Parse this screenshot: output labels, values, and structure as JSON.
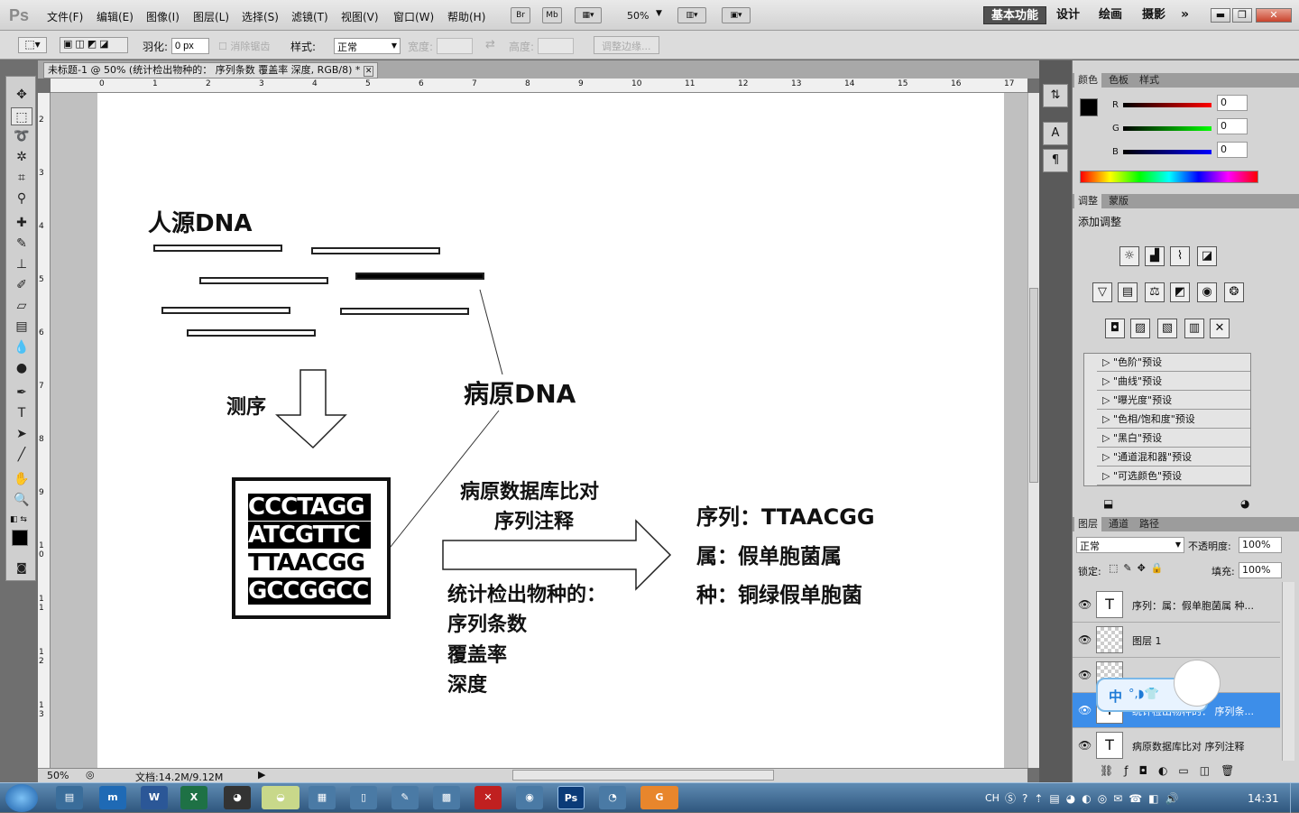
{
  "app": {
    "logo": "Ps"
  },
  "menu": [
    "文件(F)",
    "编辑(E)",
    "图像(I)",
    "图层(L)",
    "选择(S)",
    "滤镜(T)",
    "视图(V)",
    "窗口(W)",
    "帮助(H)"
  ],
  "menubar_buttons": {
    "br": "Br",
    "mb": "Mb",
    "zoom": "50%"
  },
  "workspaces": [
    "基本功能",
    "设计",
    "绘画",
    "摄影"
  ],
  "options": {
    "feather_label": "羽化:",
    "feather_value": "0 px",
    "antialias": "消除锯齿",
    "style_label": "样式:",
    "style_value": "正常",
    "width_label": "宽度:",
    "height_label": "高度:",
    "refine_btn": "调整边缘..."
  },
  "document": {
    "tab_title": "未标题-1 @ 50% (统计检出物种的： 序列条数 覆盖率 深度, RGB/8) *"
  },
  "ruler_top": [
    "0",
    "1",
    "2",
    "3",
    "4",
    "5",
    "6",
    "7",
    "8",
    "9",
    "10",
    "11",
    "12",
    "13",
    "14",
    "15",
    "16",
    "17"
  ],
  "ruler_left": [
    "2",
    "3",
    "4",
    "5",
    "6",
    "7",
    "8",
    "9",
    "1 0",
    "1 1",
    "1 2",
    "1 3"
  ],
  "canvas": {
    "human_dna": "人源DNA",
    "sequencing": "测序",
    "pathogen_dna": "病原DNA",
    "seq_lines": [
      "CCCTAGG",
      "ATCGTTC",
      "TTAACGG",
      "GCCGGCC"
    ],
    "db_compare": "病原数据库比对",
    "seq_annot": "序列注释",
    "stats_title": "统计检出物种的：",
    "stats_items": [
      "序列条数",
      "覆盖率",
      "深度"
    ],
    "result_seq": "序列：TTAACGG",
    "result_genus": "属：假单胞菌属",
    "result_species": "种：铜绿假单胞菌"
  },
  "status": {
    "zoom": "50%",
    "doc": "文档:14.2M/9.12M"
  },
  "color_panel": {
    "tabs": [
      "颜色",
      "色板",
      "样式"
    ],
    "r": "0",
    "g": "0",
    "b": "0",
    "r_label": "R",
    "g_label": "G",
    "b_label": "B"
  },
  "adjust_panel": {
    "tabs": [
      "调整",
      "蒙版"
    ],
    "title": "添加调整",
    "presets": [
      "\"色阶\"预设",
      "\"曲线\"预设",
      "\"曝光度\"预设",
      "\"色相/饱和度\"预设",
      "\"黑白\"预设",
      "\"通道混和器\"预设",
      "\"可选颜色\"预设"
    ]
  },
  "layers_panel": {
    "tabs": [
      "图层",
      "通道",
      "路径"
    ],
    "blend": "正常",
    "opacity_label": "不透明度:",
    "opacity": "100%",
    "lock_label": "锁定:",
    "fill_label": "填充:",
    "fill": "100%",
    "layers": [
      "序列：属：假单胞菌属 种...",
      "图层 1",
      "",
      "统计检出物种的： 序列条...",
      "病原数据库比对 序列注释"
    ]
  },
  "ime": {
    "label": "中"
  },
  "taskbar": {
    "lang": "CH",
    "time": "14:31"
  }
}
